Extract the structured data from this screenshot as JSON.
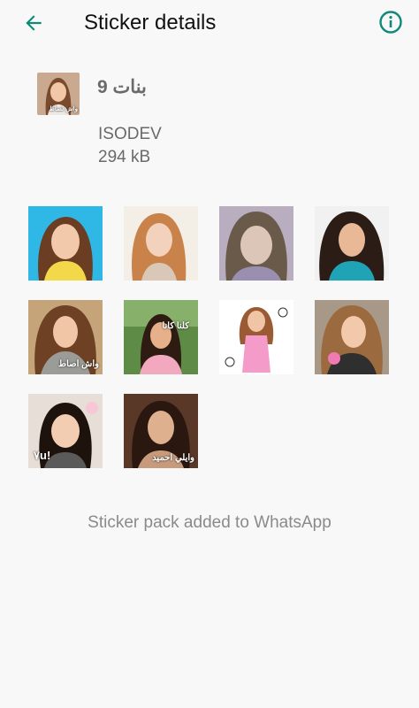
{
  "header": {
    "title": "Sticker details",
    "back_icon": "arrow-left-icon",
    "info_icon": "info-circle-icon",
    "accent": "#0f8a7a"
  },
  "pack": {
    "name": "بنات 9",
    "publisher": "ISODEV",
    "size": "294 kB",
    "icon_caption": "واش لصاط"
  },
  "stickers": [
    {
      "caption": ""
    },
    {
      "caption": ""
    },
    {
      "caption": ""
    },
    {
      "caption": ""
    },
    {
      "caption": "واش اصاط"
    },
    {
      "caption": "كلنا كانا"
    },
    {
      "caption": ""
    },
    {
      "caption": ""
    },
    {
      "caption": "!٧u"
    },
    {
      "caption": "وايلي احميد"
    }
  ],
  "status": "Sticker pack added to WhatsApp"
}
